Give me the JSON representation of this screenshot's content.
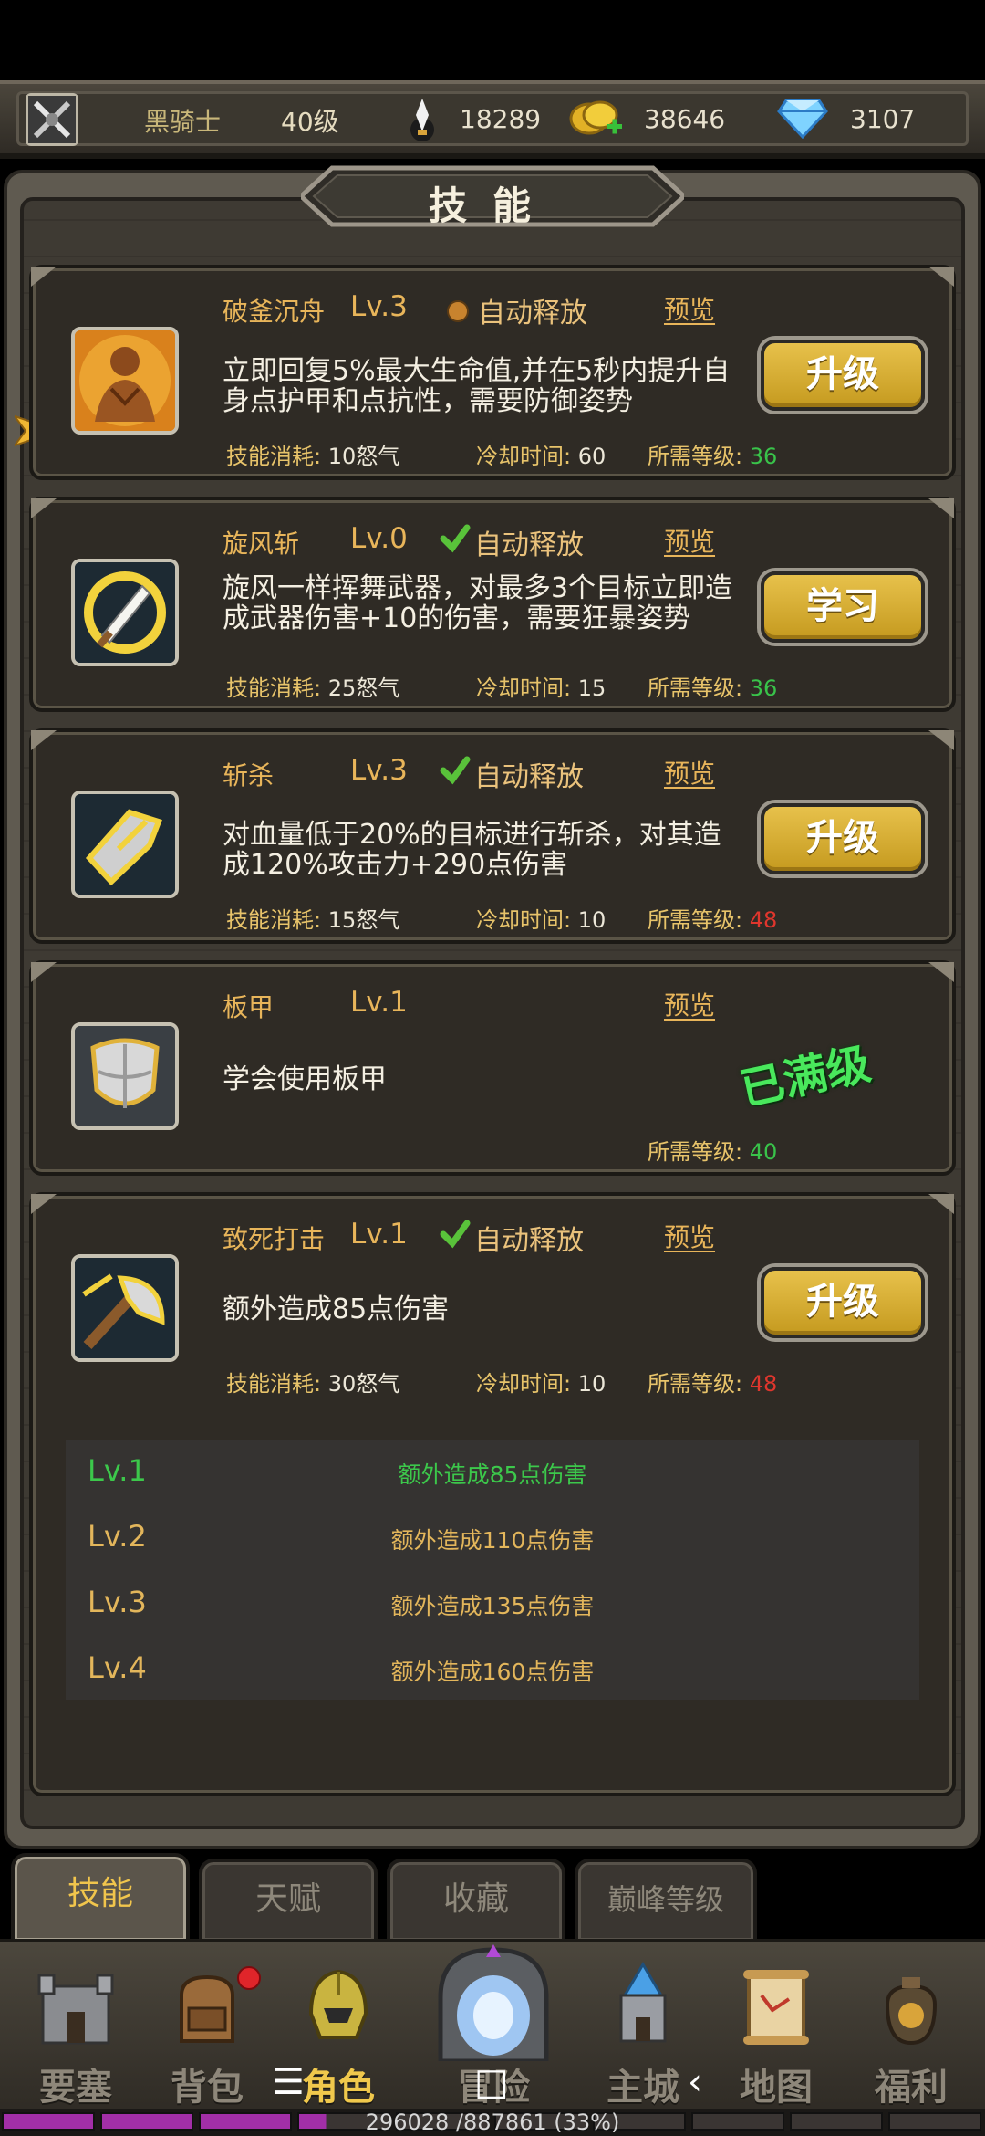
{
  "top": {
    "name": "黑骑士",
    "level": "40级",
    "stamina": "18289",
    "gold": "38646",
    "diamond": "3107"
  },
  "title": "技能",
  "skills": [
    {
      "name": "破釜沉舟",
      "level": "Lv.3",
      "auto": "自动释放",
      "auto_on": false,
      "preview": "预览",
      "desc": "立即回复5%最大生命值,并在5秒内提升自身点护甲和点抗性，需要防御姿势",
      "cost_label": "技能消耗:",
      "cost": "10怒气",
      "cd_label": "冷却时间:",
      "cd": "60",
      "req_label": "所需等级:",
      "req": "36",
      "req_ok": true,
      "button": "升级"
    },
    {
      "name": "旋风斩",
      "level": "Lv.0",
      "auto": "自动释放",
      "auto_on": true,
      "preview": "预览",
      "desc": "旋风一样挥舞武器，对最多3个目标立即造成武器伤害+10的伤害，需要狂暴姿势",
      "cost_label": "技能消耗:",
      "cost": "25怒气",
      "cd_label": "冷却时间:",
      "cd": "15",
      "req_label": "所需等级:",
      "req": "36",
      "req_ok": true,
      "button": "学习"
    },
    {
      "name": "斩杀",
      "level": "Lv.3",
      "auto": "自动释放",
      "auto_on": true,
      "preview": "预览",
      "desc": "对血量低于20%的目标进行斩杀，对其造成120%攻击力+290点伤害",
      "cost_label": "技能消耗:",
      "cost": "15怒气",
      "cd_label": "冷却时间:",
      "cd": "10",
      "req_label": "所需等级:",
      "req": "48",
      "req_ok": false,
      "button": "升级"
    },
    {
      "name": "板甲",
      "level": "Lv.1",
      "preview": "预览",
      "desc": "学会使用板甲",
      "req_label": "所需等级:",
      "req": "40",
      "req_ok": true,
      "maxed": "已满级"
    },
    {
      "name": "致死打击",
      "level": "Lv.1",
      "auto": "自动释放",
      "auto_on": true,
      "preview": "预览",
      "desc": "额外造成85点伤害",
      "cost_label": "技能消耗:",
      "cost": "30怒气",
      "cd_label": "冷却时间:",
      "cd": "10",
      "req_label": "所需等级:",
      "req": "48",
      "req_ok": false,
      "button": "升级"
    }
  ],
  "levels": [
    {
      "lv": "Lv.1",
      "desc": "额外造成85点伤害",
      "current": true
    },
    {
      "lv": "Lv.2",
      "desc": "额外造成110点伤害",
      "current": false
    },
    {
      "lv": "Lv.3",
      "desc": "额外造成135点伤害",
      "current": false
    },
    {
      "lv": "Lv.4",
      "desc": "额外造成160点伤害",
      "current": false
    }
  ],
  "tabs": [
    "技能",
    "天赋",
    "收藏",
    "巅峰等级"
  ],
  "nav": [
    "要塞",
    "背包",
    "角色",
    "冒险",
    "主城",
    "地图",
    "福利"
  ],
  "xp": {
    "text": "296028 /887861 (33%)",
    "fraction": 0.33
  },
  "colors": {
    "gold": "#e8b55a",
    "ok": "#39c34a",
    "bad": "#e0362d",
    "button": "#e7c14b",
    "maxed": "#49e85c"
  }
}
